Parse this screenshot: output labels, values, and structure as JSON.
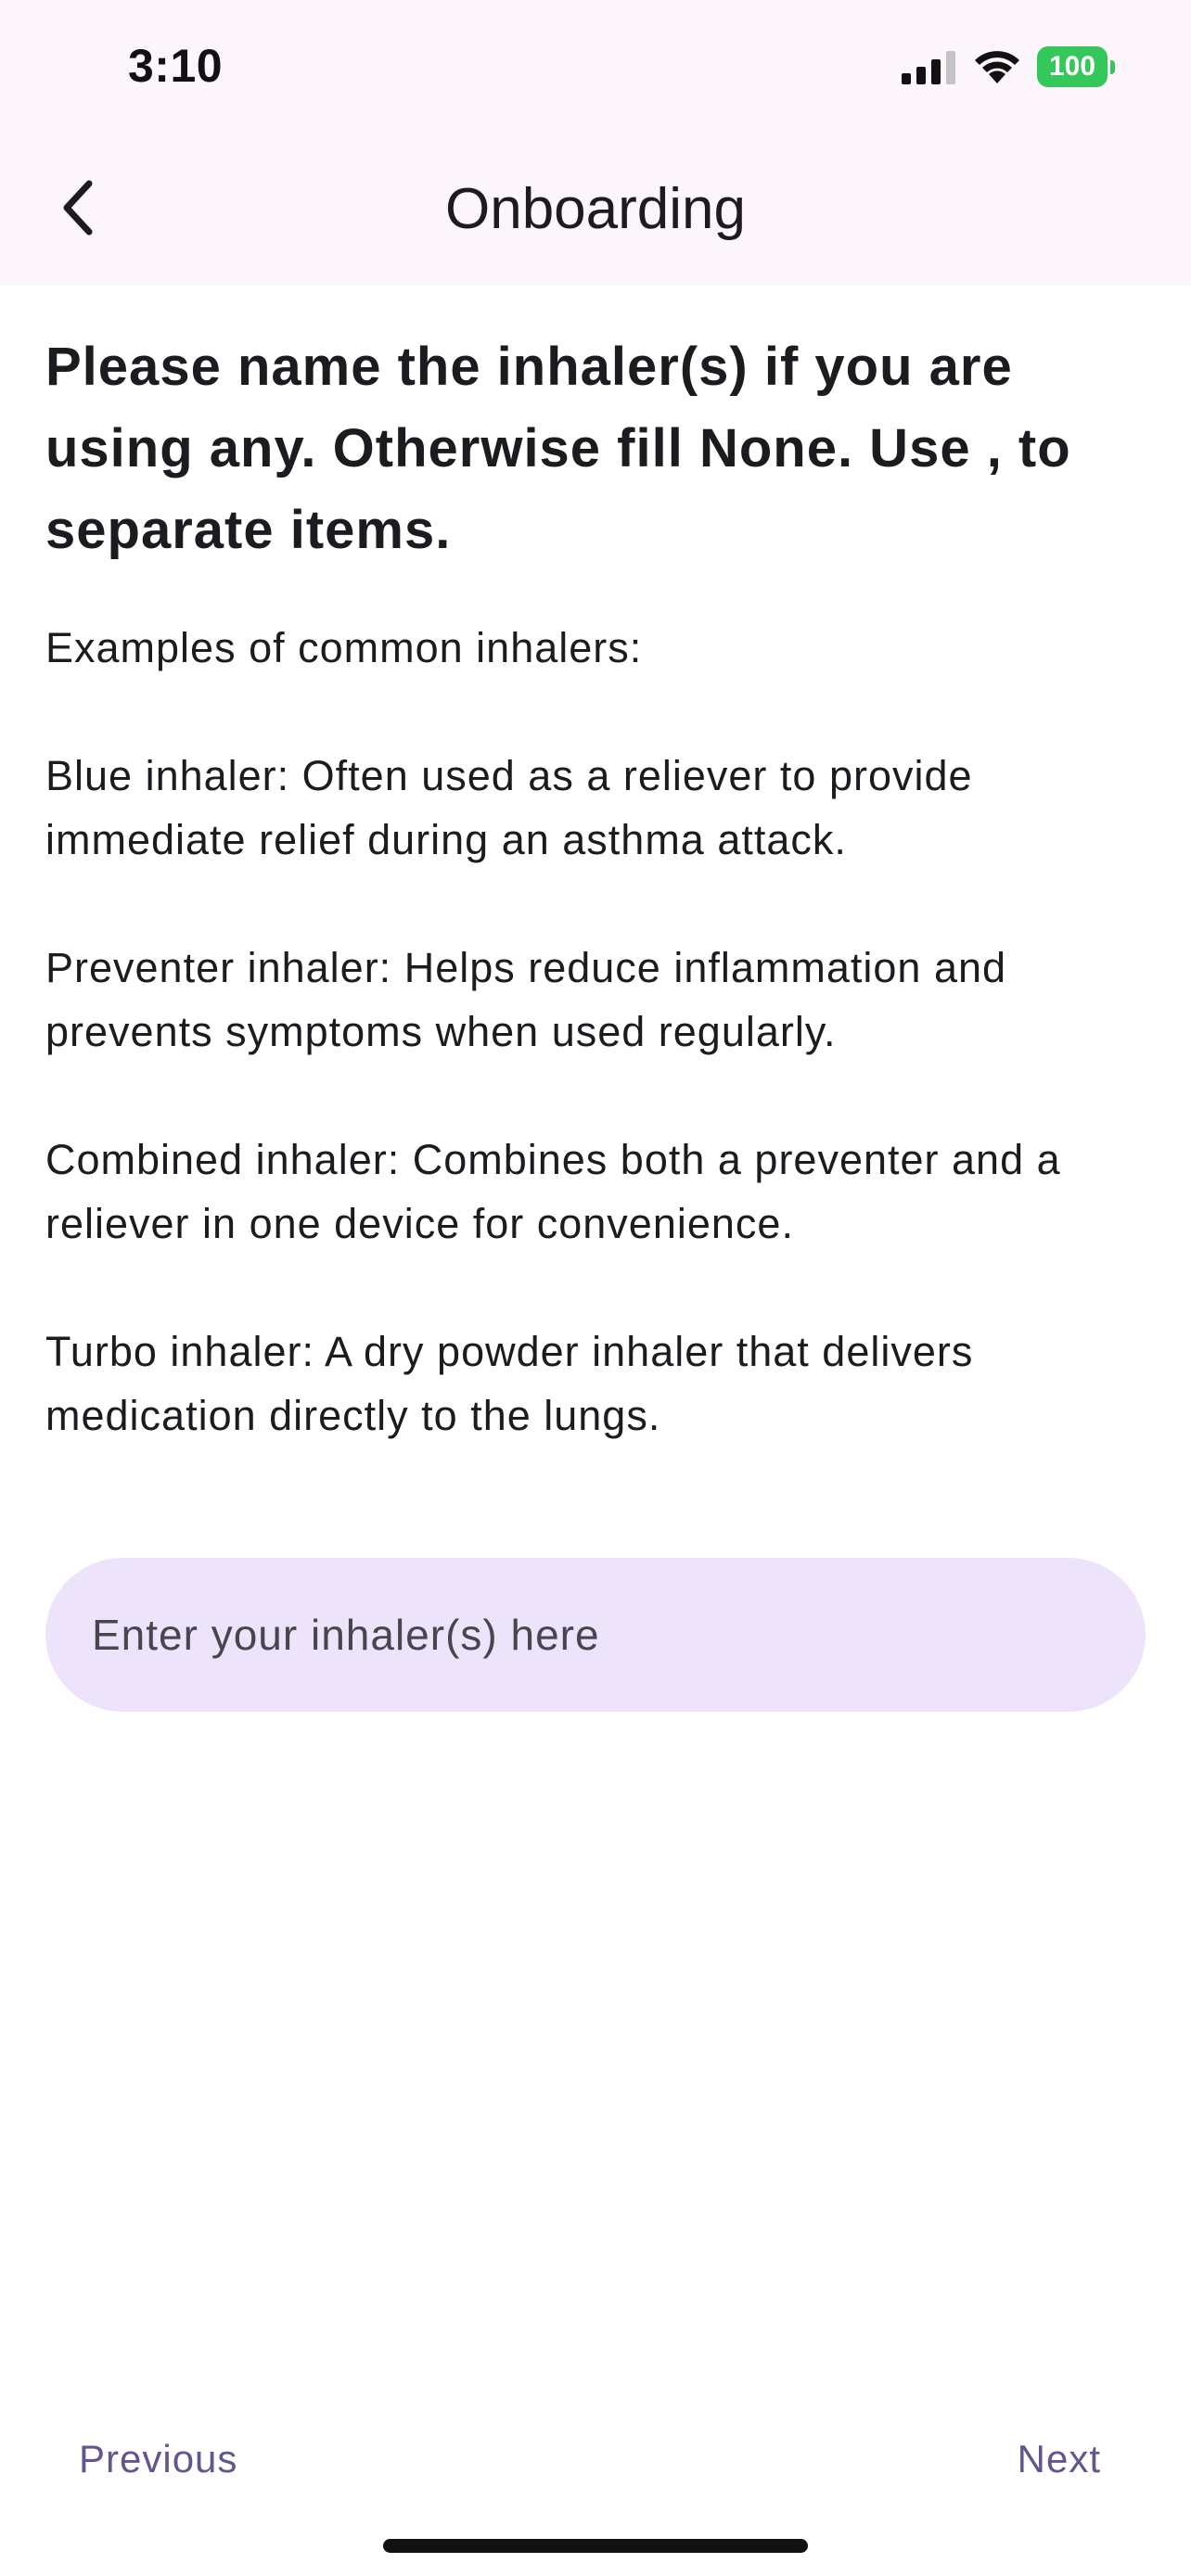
{
  "status_bar": {
    "time": "3:10",
    "battery": "100",
    "signal_icon": "cellular-signal-icon",
    "wifi_icon": "wifi-icon",
    "battery_color": "#34c759"
  },
  "header": {
    "title": "Onboarding",
    "back_icon": "chevron-left-icon",
    "background": "#fdf5fc"
  },
  "question": {
    "text": "Please name the inhaler(s) if you are using any. Otherwise fill None. Use , to separate items."
  },
  "examples": [
    "Examples of common inhalers:",
    "Blue inhaler: Often used as a reliever to provide immediate relief during an asthma attack.",
    "Preventer inhaler: Helps reduce inflammation and prevents symptoms when used regularly.",
    "Combined inhaler: Combines both a preventer and a reliever in one device for convenience.",
    "Turbo inhaler: A dry powder inhaler that delivers medication directly to the lungs."
  ],
  "input": {
    "value": "",
    "placeholder": "Enter your inhaler(s) here",
    "background": "#ede4fc"
  },
  "footer": {
    "previous_label": "Previous",
    "next_label": "Next",
    "accent": "#65558f"
  }
}
